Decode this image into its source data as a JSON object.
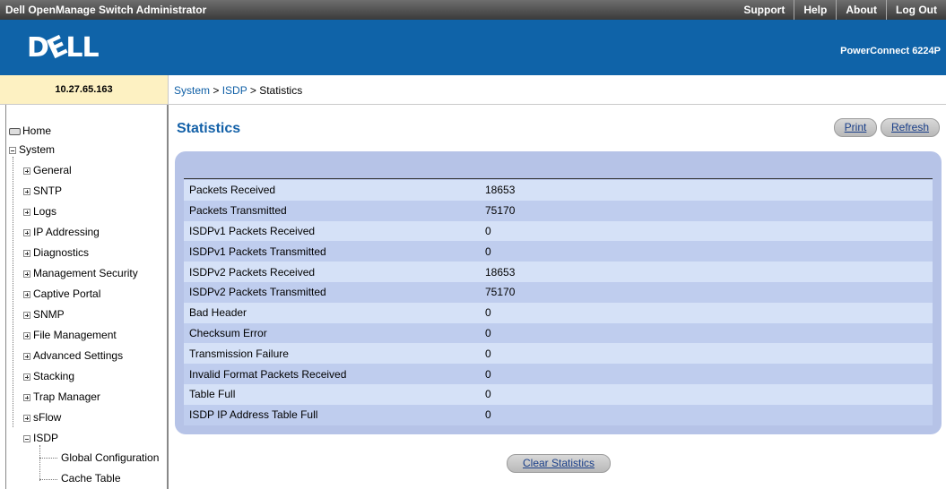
{
  "topbar": {
    "title": "Dell OpenManage Switch Administrator",
    "links": [
      "Support",
      "Help",
      "About",
      "Log Out"
    ]
  },
  "brand": {
    "logo": "DELL",
    "product": "PowerConnect 6224P"
  },
  "device": {
    "ip": "10.27.65.163"
  },
  "breadcrumb": {
    "system": "System",
    "sep1": " > ",
    "isdp": "ISDP",
    "sep2": " > ",
    "current": "Statistics"
  },
  "sidebar": {
    "home": "Home",
    "system": "System",
    "items": [
      "General",
      "SNTP",
      "Logs",
      "IP Addressing",
      "Diagnostics",
      "Management Security",
      "Captive Portal",
      "SNMP",
      "File Management",
      "Advanced Settings",
      "Stacking",
      "Trap Manager",
      "sFlow"
    ],
    "isdp": "ISDP",
    "isdp_children": [
      "Global Configuration",
      "Cache Table"
    ]
  },
  "main": {
    "title": "Statistics",
    "print_label": "Print",
    "refresh_label": "Refresh",
    "clear_label": "Clear Statistics",
    "rows": [
      {
        "label": "Packets Received",
        "value": "18653"
      },
      {
        "label": "Packets Transmitted",
        "value": "75170"
      },
      {
        "label": "ISDPv1 Packets Received",
        "value": "0"
      },
      {
        "label": "ISDPv1 Packets Transmitted",
        "value": "0"
      },
      {
        "label": "ISDPv2 Packets Received",
        "value": "18653"
      },
      {
        "label": "ISDPv2 Packets Transmitted",
        "value": "75170"
      },
      {
        "label": "Bad Header",
        "value": "0"
      },
      {
        "label": "Checksum Error",
        "value": "0"
      },
      {
        "label": "Transmission Failure",
        "value": "0"
      },
      {
        "label": "Invalid Format Packets Received",
        "value": "0"
      },
      {
        "label": "Table Full",
        "value": "0"
      },
      {
        "label": "ISDP IP Address Table Full",
        "value": "0"
      }
    ]
  },
  "colors": {
    "brand_blue": "#0f63a8",
    "title_blue": "#1461a8",
    "panel": "#b6c3e7",
    "ip_bg": "#fdf1c2"
  }
}
